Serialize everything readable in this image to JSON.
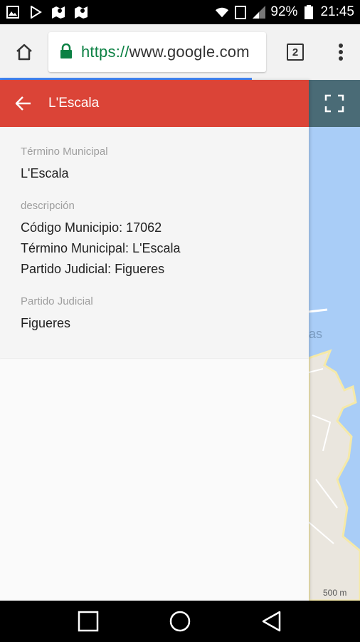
{
  "status_bar": {
    "battery": "92%",
    "time": "21:45"
  },
  "browser": {
    "url_scheme": "https://",
    "url_host": "www.google.com",
    "tab_count": "2"
  },
  "panel": {
    "title": "L'Escala",
    "fields": [
      {
        "label": "Término Municipal",
        "value": "L'Escala"
      },
      {
        "label": "descripción",
        "lines": [
          "Código Municipio: 17062",
          "Término Municipal: L'Escala",
          "Partido Judicial: Figueres"
        ]
      },
      {
        "label": "Partido Judicial",
        "value": "Figueres"
      }
    ]
  },
  "map": {
    "scale": "500 m",
    "partial_label": "as"
  },
  "colors": {
    "header_red": "#db4437",
    "map_water": "#a9cdf7",
    "map_header": "#4a6b76",
    "url_scheme_green": "#0b8043",
    "progress_blue": "#4285f4"
  }
}
